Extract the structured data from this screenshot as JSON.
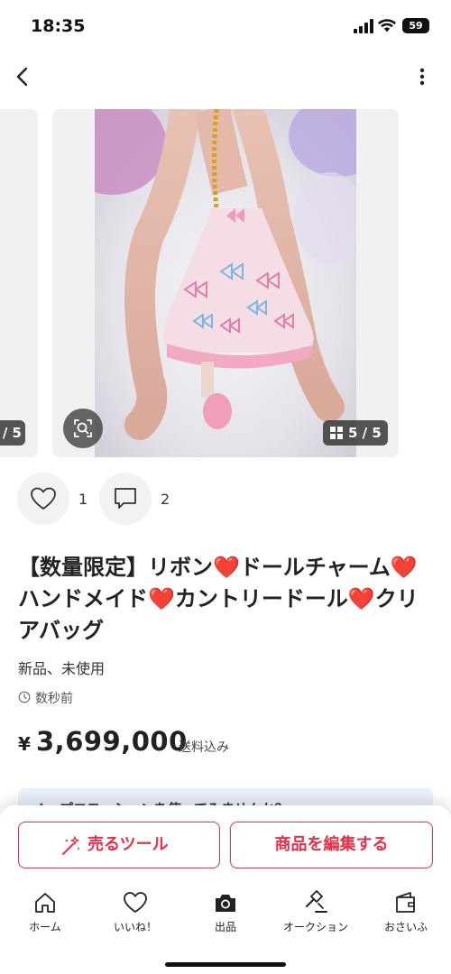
{
  "status_bar": {
    "time": "18:35",
    "battery": "59"
  },
  "carousel": {
    "prev_counter": "/ 5",
    "counter": "5 / 5"
  },
  "reactions": {
    "likes": "1",
    "comments": "2"
  },
  "item": {
    "title": "【数量限定】リボン❤️ドールチャーム❤️ハンドメイド❤️カントリードール❤️クリアバッグ",
    "condition": "新品、未使用",
    "listed_time": "数秒前",
    "price_symbol": "¥",
    "price": "3,699,000",
    "price_note": "送料込み"
  },
  "promo": {
    "text": "プロモーションを使ってみませんか？"
  },
  "actions": {
    "sell_tool": "売るツール",
    "edit_item": "商品を編集する"
  },
  "tab_bar": {
    "home": "ホーム",
    "likes": "いいね！",
    "sell": "出品",
    "auction": "オークション",
    "wallet": "おさいふ"
  },
  "colors": {
    "accent": "#e8304a",
    "promo_bg": "#eaf1fb"
  }
}
